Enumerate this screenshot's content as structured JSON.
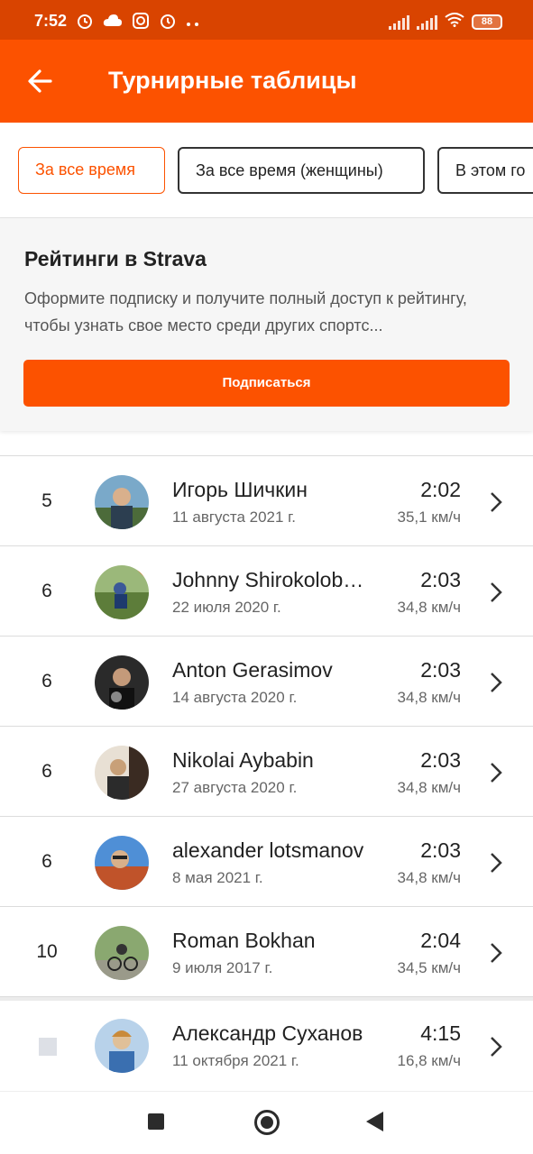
{
  "status_bar": {
    "time": "7:52",
    "battery": "88",
    "icons": [
      "alarm-clock-icon",
      "cloud-icon",
      "instagram-icon",
      "alarm-icon",
      "more-dots-icon",
      "signal-icon",
      "signal-icon",
      "wifi-icon",
      "battery-icon"
    ]
  },
  "header": {
    "title": "Турнирные таблицы",
    "back_icon": "back-arrow-icon",
    "color": "#fc5200"
  },
  "filters": [
    {
      "label": "За все время",
      "active": true
    },
    {
      "label": "За все время (женщины)",
      "active": false
    },
    {
      "label": "В этом го",
      "active": false
    }
  ],
  "promo": {
    "title": "Рейтинги в Strava",
    "text": "Оформите подписку и получите полный доступ к рейтингу, чтобы узнать свое место среди других спортс...",
    "button": "Подписаться"
  },
  "rows": [
    {
      "rank": "5",
      "name": "Игорь Шичкин",
      "date": "11 августа 2021 г.",
      "time": "2:02",
      "speed": "35,1 км/ч"
    },
    {
      "rank": "6",
      "name": "Johnny Shirokolob…",
      "date": "22 июля 2020 г.",
      "time": "2:03",
      "speed": "34,8 км/ч"
    },
    {
      "rank": "6",
      "name": "Anton Gerasimov",
      "date": "14 августа 2020 г.",
      "time": "2:03",
      "speed": "34,8 км/ч"
    },
    {
      "rank": "6",
      "name": "Nikolai Aybabin",
      "date": "27 августа 2020 г.",
      "time": "2:03",
      "speed": "34,8 км/ч"
    },
    {
      "rank": "6",
      "name": "alexander lotsmanov",
      "date": "8 мая 2021 г.",
      "time": "2:03",
      "speed": "34,8 км/ч"
    },
    {
      "rank": "10",
      "name": "Roman Bokhan",
      "date": "9 июля 2017 г.",
      "time": "2:04",
      "speed": "34,5 км/ч"
    }
  ],
  "my_result": {
    "name": "Александр Суханов",
    "date": "11 октября 2021 г.",
    "time": "4:15",
    "speed": "16,8 км/ч"
  },
  "nav": {
    "icons": [
      "recents-square-icon",
      "home-circle-icon",
      "back-triangle-icon"
    ]
  }
}
